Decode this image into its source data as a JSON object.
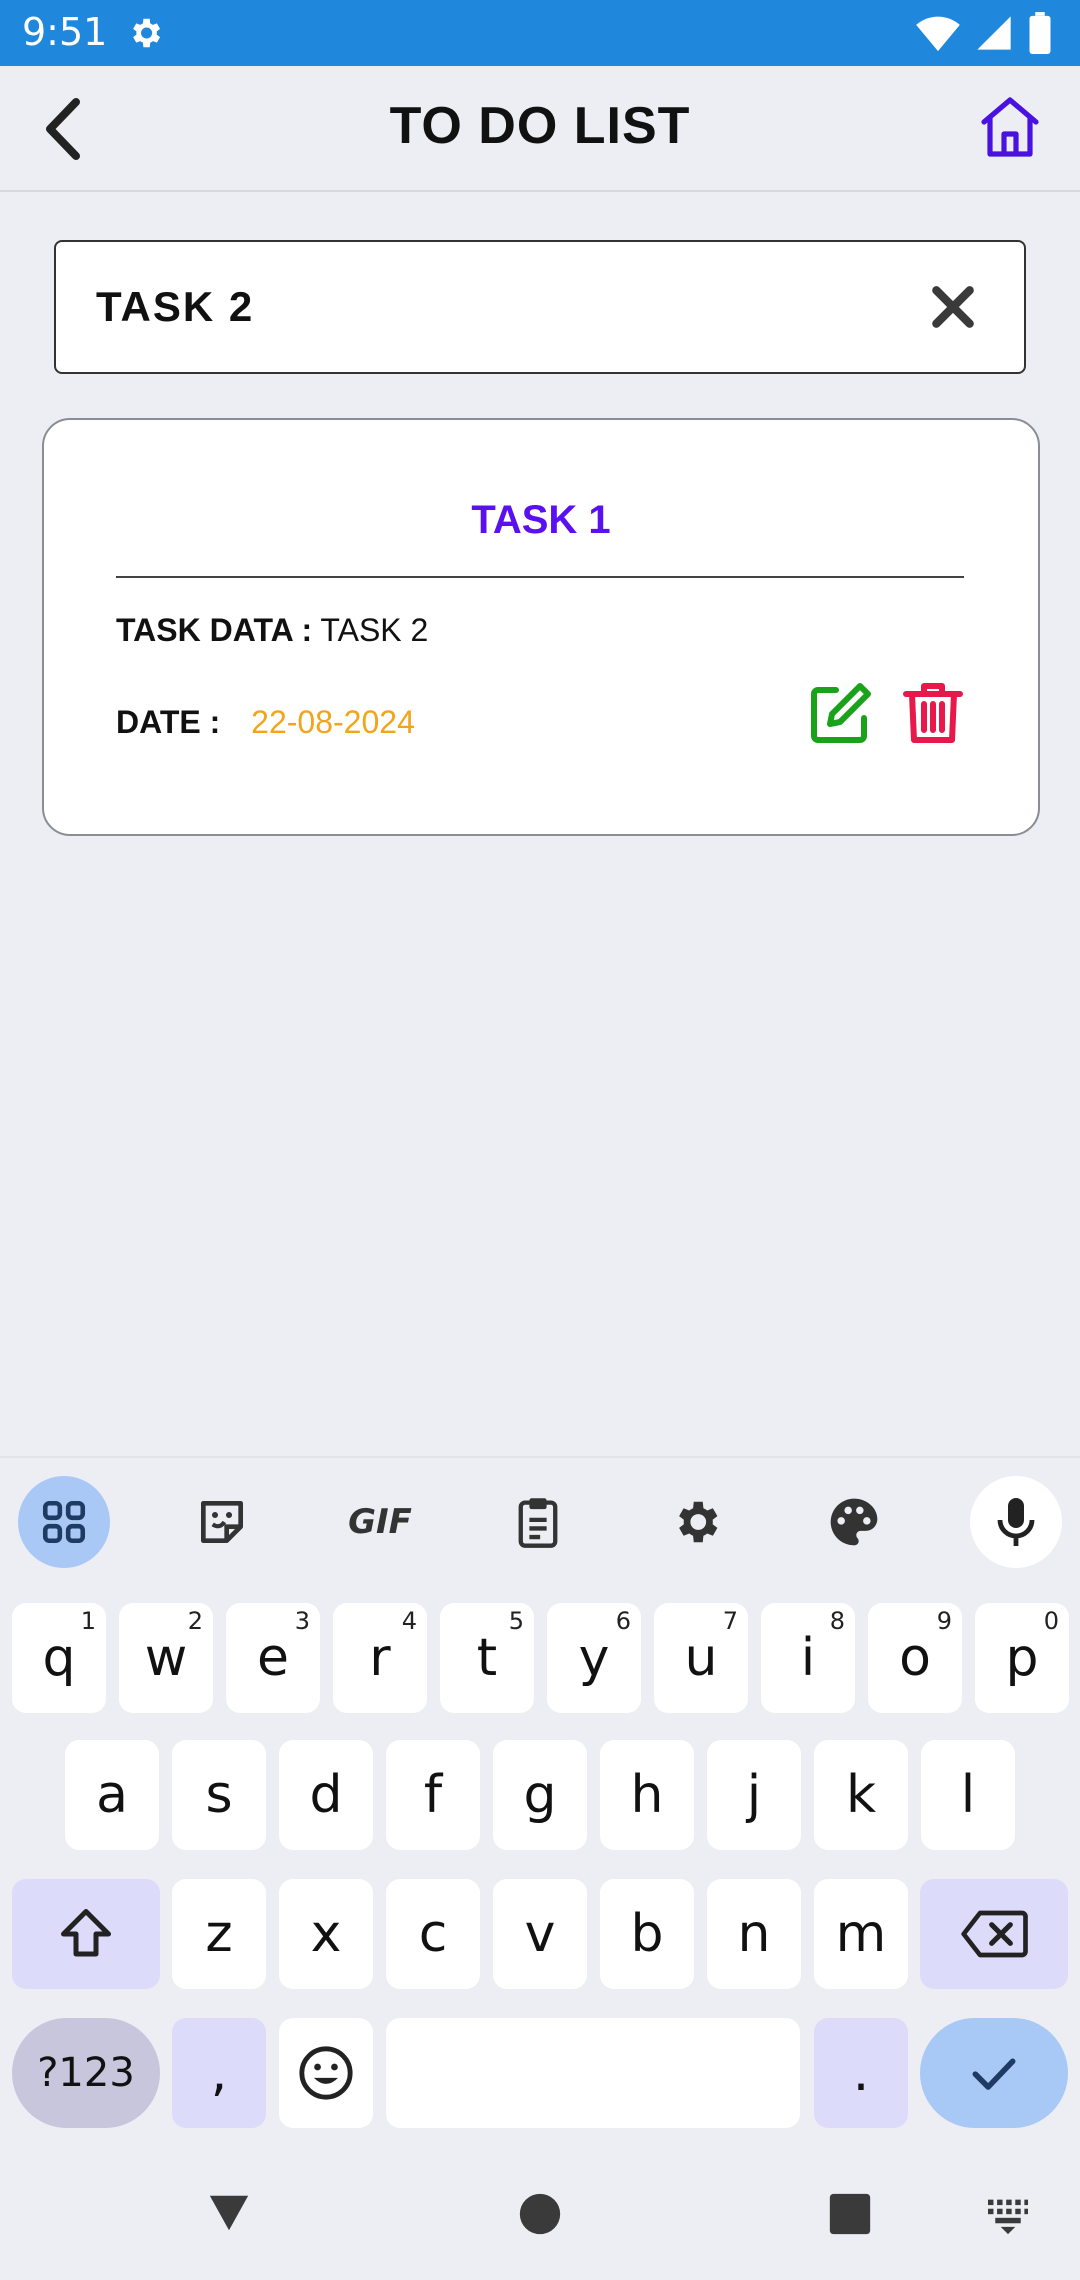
{
  "status_bar": {
    "time": "9:51",
    "icons": [
      "settings-icon",
      "wifi-icon",
      "signal-icon",
      "battery-icon"
    ]
  },
  "app_bar": {
    "title": "TO DO LIST",
    "back_icon": "chevron-left-icon",
    "home_icon": "home-icon"
  },
  "search": {
    "value": "TASK 2",
    "clear_icon": "close-icon"
  },
  "task_card": {
    "title": "TASK 1",
    "data_label": "TASK DATA :",
    "data_value": "TASK 2",
    "date_label": "DATE :",
    "date_value": "22-08-2024",
    "edit_icon": "edit-icon",
    "delete_icon": "trash-icon"
  },
  "keyboard": {
    "toolbar": [
      "apps-grid-icon",
      "sticker-icon",
      "GIF",
      "clipboard-icon",
      "settings-icon",
      "palette-icon",
      "mic-icon"
    ],
    "row1": [
      {
        "key": "q",
        "hint": "1"
      },
      {
        "key": "w",
        "hint": "2"
      },
      {
        "key": "e",
        "hint": "3"
      },
      {
        "key": "r",
        "hint": "4"
      },
      {
        "key": "t",
        "hint": "5"
      },
      {
        "key": "y",
        "hint": "6"
      },
      {
        "key": "u",
        "hint": "7"
      },
      {
        "key": "i",
        "hint": "8"
      },
      {
        "key": "o",
        "hint": "9"
      },
      {
        "key": "p",
        "hint": "0"
      }
    ],
    "row2": [
      "a",
      "s",
      "d",
      "f",
      "g",
      "h",
      "j",
      "k",
      "l"
    ],
    "row3": [
      "z",
      "x",
      "c",
      "v",
      "b",
      "n",
      "m"
    ],
    "row4": {
      "symbols": "?123",
      "comma": ",",
      "period": "."
    }
  },
  "colors": {
    "status_bar": "#1f87dc",
    "title_accent": "#5a10f0",
    "date": "#f2a51a",
    "edit": "#1aa31a",
    "delete": "#e8194a",
    "home": "#4a12e0"
  }
}
